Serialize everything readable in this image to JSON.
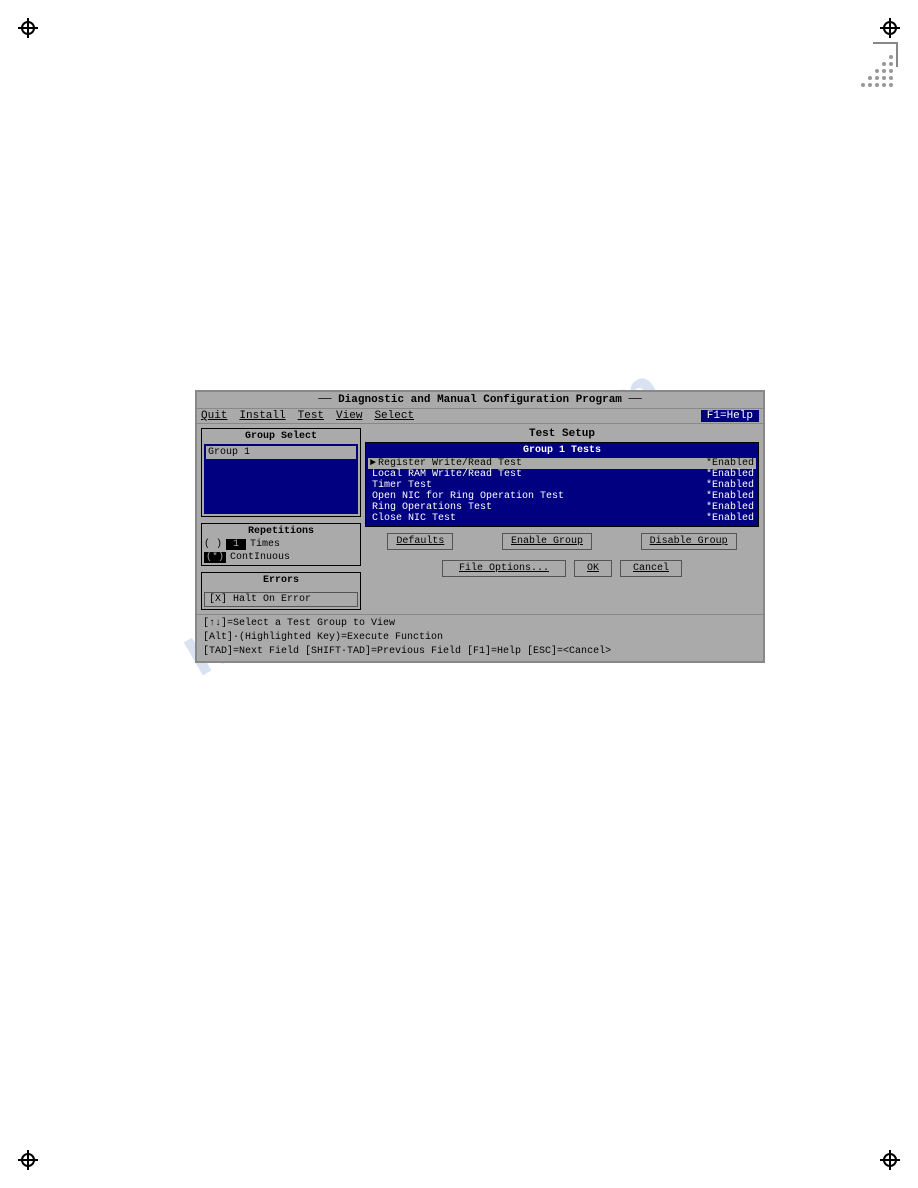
{
  "page": {
    "background": "#ffffff"
  },
  "watermark": "manualslib.com",
  "decorative": {
    "dots_rows": [
      [
        1
      ],
      [
        1,
        1
      ],
      [
        1,
        1,
        1
      ],
      [
        1,
        1,
        1,
        1
      ],
      [
        1,
        1,
        1,
        1,
        1
      ]
    ]
  },
  "terminal": {
    "title": "Diagnostic and Manual Configuration Program",
    "menu": {
      "items": [
        "Quit",
        "Install",
        "Test",
        "View",
        "Select"
      ],
      "help": "F1=Help"
    },
    "test_setup": {
      "header": "Test Setup",
      "group_select": {
        "title": "Group Select",
        "groups": [
          "Group 1"
        ]
      },
      "group1_tests": {
        "title": "Group 1 Tests",
        "tests": [
          {
            "arrow": "►",
            "name": "Register Write/Read Test",
            "status": "*Enabled",
            "highlighted": true
          },
          {
            "arrow": "",
            "name": "Local RAM Write/Read Test",
            "status": "*Enabled",
            "highlighted": false
          },
          {
            "arrow": "",
            "name": "Timer Test",
            "status": "*Enabled",
            "highlighted": false
          },
          {
            "arrow": "",
            "name": "Open NIC for Ring Operation Test",
            "status": "*Enabled",
            "highlighted": false
          },
          {
            "arrow": "",
            "name": "Ring Operations Test",
            "status": "*Enabled",
            "highlighted": false
          },
          {
            "arrow": "",
            "name": "Close NIC Test",
            "status": "*Enabled",
            "highlighted": false
          }
        ]
      },
      "repetitions": {
        "title": "Repetitions",
        "times_label": "Times",
        "times_value": "1",
        "continuous_label": "ContInuous",
        "radio_indicator": "(*)"
      },
      "errors": {
        "title": "Errors",
        "halt_label": "[X] Halt On Error"
      },
      "action_buttons": {
        "defaults": "Defaults",
        "enable_group": "Enable Group",
        "disable_group": "Disable Group"
      },
      "bottom_buttons": {
        "file_options": "File Options...",
        "ok": "OK",
        "cancel": "Cancel"
      }
    },
    "status_lines": [
      "[↑↓]=Select a Test Group to View",
      "[Alt]·(Highlighted Key)=Execute Function",
      "[TAD]=Next Field  [SHIFT·TAD]=Previous Field  [F1]=Help  [ESC]=<Cancel>"
    ]
  }
}
